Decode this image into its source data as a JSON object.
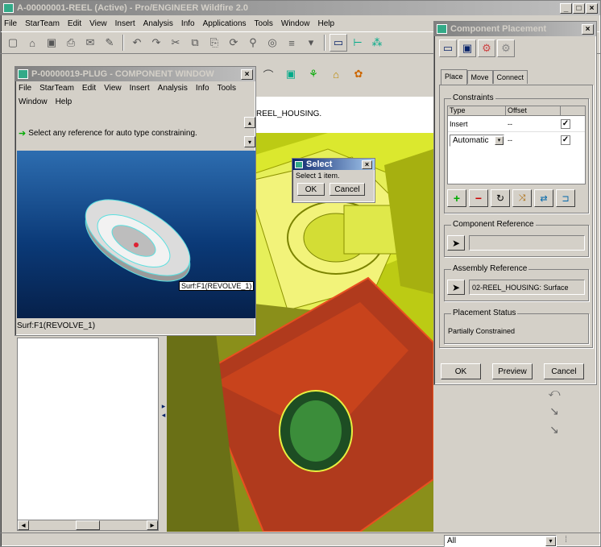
{
  "main_window": {
    "title": "A-00000001-REEL (Active) - Pro/ENGINEER Wildfire 2.0",
    "menu": [
      "File",
      "StarTeam",
      "Edit",
      "View",
      "Insert",
      "Analysis",
      "Info",
      "Applications",
      "Tools",
      "Window",
      "Help"
    ],
    "model_label": "REEL_HOUSING."
  },
  "component_window": {
    "title": "P-00000019-PLUG - COMPONENT WINDOW",
    "menu_row1": [
      "File",
      "StarTeam",
      "Edit",
      "View",
      "Insert",
      "Analysis",
      "Info",
      "Tools"
    ],
    "menu_row2": [
      "Window",
      "Help"
    ],
    "message": "Select any reference for auto type constraining.",
    "surface_tag": "Surf:F1(REVOLVE_1)",
    "status": "Surf:F1(REVOLVE_1)"
  },
  "select_dialog": {
    "title": "Select",
    "prompt": "Select 1 item.",
    "ok_label": "OK",
    "cancel_label": "Cancel"
  },
  "placement_dialog": {
    "title": "Component Placement",
    "tabs": [
      "Place",
      "Move",
      "Connect"
    ],
    "constraints_label": "Constraints",
    "col_type": "Type",
    "col_offset": "Offset",
    "rows": [
      {
        "type": "Insert",
        "offset": "--"
      },
      {
        "type": "Automatic",
        "offset": "--"
      }
    ],
    "component_ref_label": "Component Reference",
    "component_ref_value": "",
    "assembly_ref_label": "Assembly Reference",
    "assembly_ref_value": "02-REEL_HOUSING: Surface",
    "placement_status_label": "Placement Status",
    "placement_status_value": "Partially Constrained",
    "ok_label": "OK",
    "preview_label": "Preview",
    "cancel_label": "Cancel"
  },
  "filter": {
    "value": "All"
  },
  "colors": {
    "title_active": "#0a246a",
    "viewport_yellow": "#cde000",
    "red_face": "#c8431c",
    "component_bg": "#0b3a78"
  }
}
